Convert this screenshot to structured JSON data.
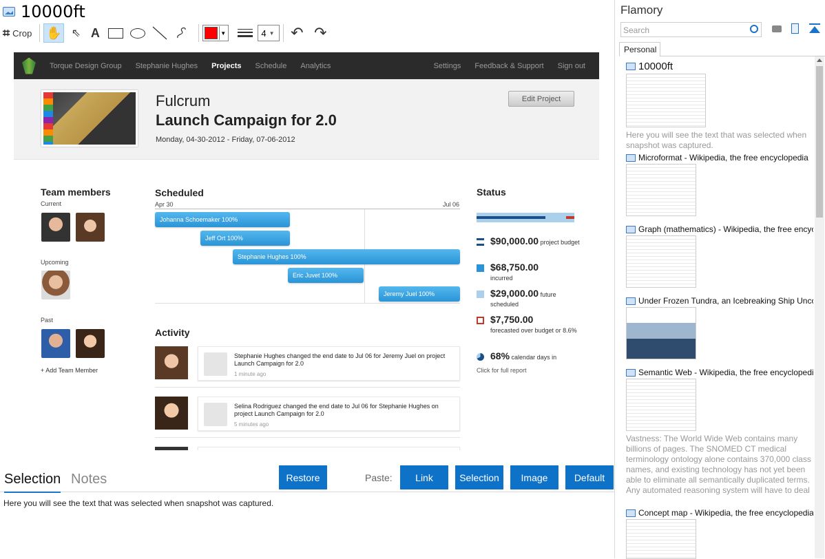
{
  "window": {
    "title": "10000ft"
  },
  "toolbar": {
    "crop_label": "Crop",
    "line_width": "4",
    "color": "#ff0000"
  },
  "snapshot": {
    "nav": {
      "items": [
        "Torque Design Group",
        "Stephanie Hughes",
        "Projects",
        "Schedule",
        "Analytics"
      ],
      "right": [
        "Settings",
        "Feedback & Support",
        "Sign out"
      ]
    },
    "project": {
      "name": "Fulcrum",
      "title": "Launch Campaign for 2.0",
      "dates": "Monday, 04-30-2012 - Friday, 07-06-2012",
      "edit_label": "Edit Project"
    },
    "team": {
      "heading": "Team members",
      "current": "Current",
      "upcoming": "Upcoming",
      "past": "Past",
      "add": "+ Add Team Member"
    },
    "scheduled": {
      "heading": "Scheduled",
      "start": "Apr 30",
      "end": "Jul 06",
      "bars": [
        "Johanna Schoemaker 100%",
        "Jeff Ort 100%",
        "Stephanie Hughes 100%",
        "Eric Juvet 100%",
        "Jeremy Juel 100%"
      ]
    },
    "status": {
      "heading": "Status",
      "items": [
        {
          "amount": "$90,000.00",
          "label": "project budget",
          "color": "#1b4f8a"
        },
        {
          "amount": "$68,750.00",
          "label": "incurred",
          "color": "#2a94d6"
        },
        {
          "amount": "$29,000.00",
          "label": "future scheduled",
          "color": "#aad0ec"
        },
        {
          "amount": "$7,750.00",
          "label": "forecasted over budget or 8.6%",
          "color": "#c0392b"
        },
        {
          "amount": "68%",
          "label": "calendar days in",
          "color": "#2a94d6"
        }
      ],
      "link": "Click for full report"
    },
    "activity": {
      "heading": "Activity",
      "items": [
        {
          "msg": "Stephanie Hughes changed the end date to Jul 06 for Jeremy Juel on project Launch Campaign for 2.0",
          "when": "1 minute ago"
        },
        {
          "msg": "Selina Rodriguez changed the end date to Jul 06 for Stephanie Hughes on project Launch Campaign for 2.0",
          "when": "5 minutes ago"
        }
      ]
    }
  },
  "bottom": {
    "tab_selection": "Selection",
    "tab_notes": "Notes",
    "restore": "Restore",
    "paste_label": "Paste:",
    "link": "Link",
    "selection": "Selection",
    "image": "Image",
    "default": "Default",
    "selection_text": "Here you will see the text that was selected when snapshot was captured."
  },
  "sidebar": {
    "app": "Flamory",
    "search_placeholder": "Search",
    "tab": "Personal",
    "entries": [
      {
        "title": "10000ft",
        "desc": "Here you will see the text that was selected when snapshot was captured."
      },
      {
        "title": "Microformat - Wikipedia, the free encyclopedia",
        "desc": ""
      },
      {
        "title": "Graph (mathematics) - Wikipedia, the free encyclopedia",
        "desc": ""
      },
      {
        "title": "Under Frozen Tundra, an Icebreaking Ship Uncovers",
        "desc": ""
      },
      {
        "title": "Semantic Web - Wikipedia, the free encyclopedia",
        "desc": "Vastness: The World Wide Web contains many billions of pages. The SNOMED CT medical terminology ontology alone contains 370,000 class names, and existing technology has not yet been able to eliminate all semantically duplicated terms. Any automated reasoning system will have to deal with truly huge inputs."
      },
      {
        "title": "Concept map - Wikipedia, the free encyclopedia",
        "desc": ""
      }
    ]
  }
}
